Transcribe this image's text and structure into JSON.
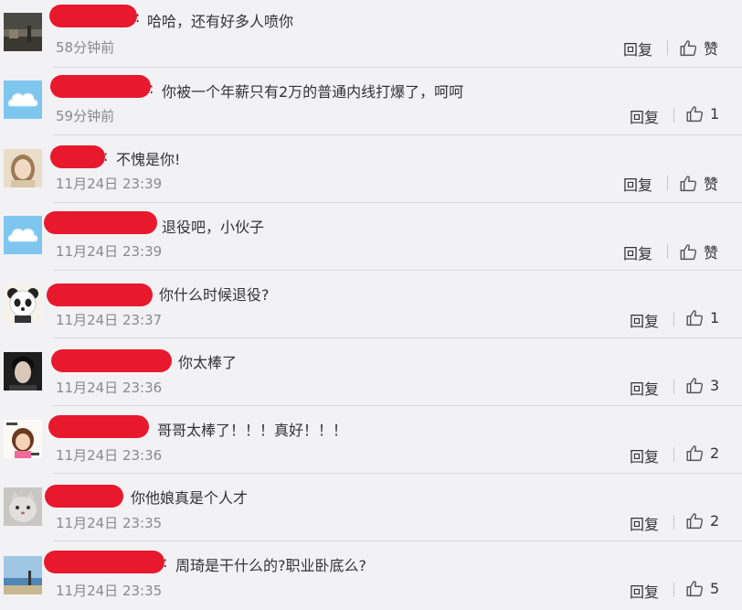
{
  "actions": {
    "reply_label": "回复"
  },
  "comments": [
    {
      "text": "哈哈，还有好多人喷你",
      "time": "58分钟前",
      "like": "赞",
      "colon": ":"
    },
    {
      "text": "你被一个年薪只有2万的普通内线打爆了，呵呵",
      "time": "59分钟前",
      "like": "1",
      "colon": ":"
    },
    {
      "text": "不愧是你!",
      "time": "11月24日 23:39",
      "like": "赞",
      "colon": ":"
    },
    {
      "text": "退役吧，小伙子",
      "time": "11月24日 23:39",
      "like": "赞",
      "colon": ""
    },
    {
      "text": "你什么时候退役?",
      "time": "11月24日 23:37",
      "like": "1",
      "colon": ""
    },
    {
      "text": "你太棒了",
      "time": "11月24日 23:36",
      "like": "3",
      "colon": ""
    },
    {
      "text": "哥哥太棒了！！！真好！！！",
      "time": "11月24日 23:36",
      "like": "2",
      "colon": ""
    },
    {
      "text": "你他娘真是个人才",
      "time": "11月24日 23:35",
      "like": "2",
      "colon": ""
    },
    {
      "text": "周琦是干什么的?职业卧底么?",
      "time": "11月24日 23:35",
      "like": "5",
      "colon": ":"
    }
  ],
  "icons": {
    "like": "thumbs-up-icon",
    "avatars": [
      "road-scene-avatar",
      "cloud-avatar",
      "girl-avatar",
      "cloud-avatar",
      "panda-avatar",
      "man-portrait-avatar",
      "cartoon-girl-avatar",
      "cat-avatar",
      "beach-avatar"
    ]
  },
  "colors": {
    "redaction": "#e8192c",
    "background": "#f2f2f5",
    "separator": "#d9d9de"
  }
}
